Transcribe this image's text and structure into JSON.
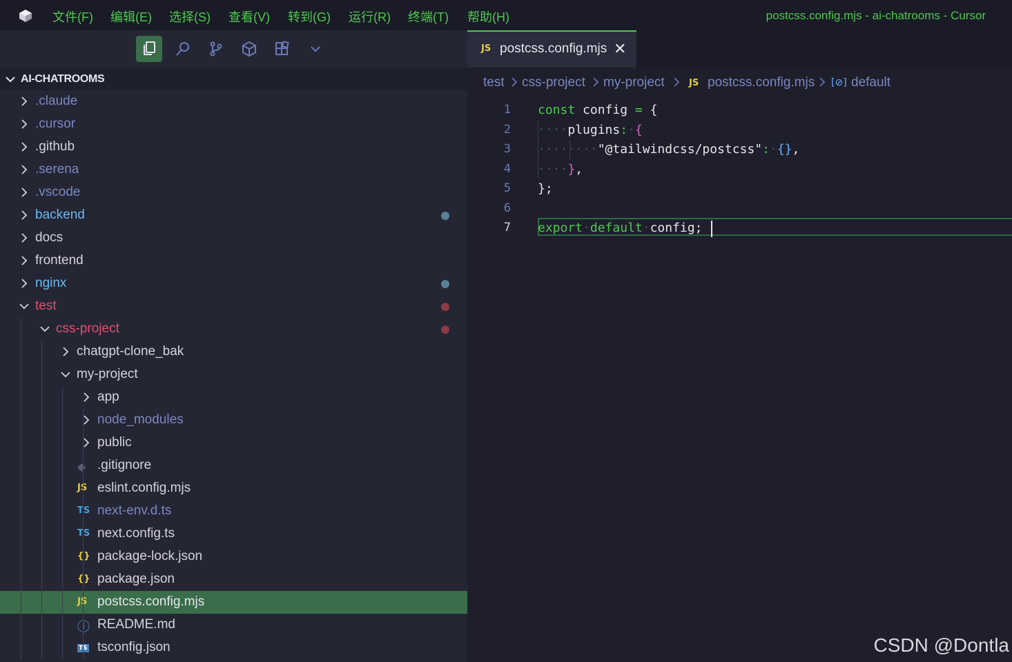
{
  "window": {
    "title": "postcss.config.mjs - ai-chatrooms - Cursor",
    "menu": [
      "文件(F)",
      "编辑(E)",
      "选择(S)",
      "查看(V)",
      "转到(G)",
      "运行(R)",
      "终端(T)",
      "帮助(H)"
    ]
  },
  "activity_bar": {
    "icons": [
      "explorer-icon",
      "search-icon",
      "source-control-icon",
      "extensions-icon",
      "extensions-grid-icon",
      "chevron-down-icon"
    ]
  },
  "explorer": {
    "root": "AI-CHATROOMS",
    "items": [
      {
        "label": ".claude",
        "type": "folder",
        "color": "#7b87c0"
      },
      {
        "label": ".cursor",
        "type": "folder",
        "color": "#7b87c0"
      },
      {
        "label": ".github",
        "type": "folder",
        "color": "#d4d4e0"
      },
      {
        "label": ".serena",
        "type": "folder",
        "color": "#7b87c0"
      },
      {
        "label": ".vscode",
        "type": "folder",
        "color": "#7b87c0"
      },
      {
        "label": "backend",
        "type": "folder",
        "color": "#6ab8f0",
        "dot": "#5b7f95"
      },
      {
        "label": "docs",
        "type": "folder",
        "color": "#d4d4e0"
      },
      {
        "label": "frontend",
        "type": "folder",
        "color": "#d4d4e0"
      },
      {
        "label": "nginx",
        "type": "folder",
        "color": "#6ab8f0",
        "dot": "#5b7f95"
      },
      {
        "label": "test",
        "type": "folder-open",
        "color": "#e0506a",
        "dot": "#8a3a48"
      },
      {
        "label": "css-project",
        "type": "folder-open",
        "color": "#e0506a",
        "dot": "#8a3a48"
      },
      {
        "label": "chatgpt-clone_bak",
        "type": "folder",
        "color": "#d4d4e0"
      },
      {
        "label": "my-project",
        "type": "folder-open",
        "color": "#d4d4e0"
      },
      {
        "label": "app",
        "type": "folder",
        "color": "#d4d4e0"
      },
      {
        "label": "node_modules",
        "type": "folder",
        "color": "#7b87c0"
      },
      {
        "label": "public",
        "type": "folder",
        "color": "#d4d4e0"
      },
      {
        "label": ".gitignore",
        "type": "file",
        "icon": "git-icon",
        "icon_text": "◆",
        "icon_color": "#5a5c70",
        "color": "#d4d4e0"
      },
      {
        "label": "eslint.config.mjs",
        "type": "file",
        "icon": "js-icon",
        "icon_text": "JS",
        "icon_color": "#e6cc44",
        "color": "#d4d4e0"
      },
      {
        "label": "next-env.d.ts",
        "type": "file",
        "icon": "ts-icon",
        "icon_text": "TS",
        "icon_color": "#4a9fd8",
        "color": "#7b87c0"
      },
      {
        "label": "next.config.ts",
        "type": "file",
        "icon": "ts-icon",
        "icon_text": "TS",
        "icon_color": "#4a9fd8",
        "color": "#d4d4e0"
      },
      {
        "label": "package-lock.json",
        "type": "file",
        "icon": "json-icon",
        "icon_text": "{}",
        "icon_color": "#e6cc44",
        "color": "#d4d4e0"
      },
      {
        "label": "package.json",
        "type": "file",
        "icon": "json-icon",
        "icon_text": "{}",
        "icon_color": "#e6cc44",
        "color": "#d4d4e0"
      },
      {
        "label": "postcss.config.mjs",
        "type": "file",
        "icon": "js-icon",
        "icon_text": "JS",
        "icon_color": "#e6cc44",
        "color": "#e6e6ee",
        "selected": true
      },
      {
        "label": "README.md",
        "type": "file",
        "icon": "info-icon",
        "icon_text": "ⓘ",
        "icon_color": "#5aa0d8",
        "color": "#d4d4e0"
      },
      {
        "label": "tsconfig.json",
        "type": "file",
        "icon": "tsconfig-icon",
        "icon_text": "TS",
        "icon_color": "#4a9fd8",
        "color": "#d4d4e0"
      }
    ]
  },
  "tab": {
    "icon": "JS",
    "label": "postcss.config.mjs",
    "close": "✕"
  },
  "breadcrumb": {
    "parts": [
      "test",
      "css-project",
      "my-project",
      "postcss.config.mjs",
      "default"
    ],
    "js_icon": "JS",
    "symbol_icon": "[⊘]"
  },
  "code": {
    "lines": [
      "1",
      "2",
      "3",
      "4",
      "5",
      "6",
      "7"
    ],
    "active_line": "7"
  },
  "watermark": "CSDN @Dontla",
  "colors": {
    "accent": "#4ec94e",
    "selection": "#3a6d4a",
    "folder_modified": "#6ab8f0",
    "folder_error": "#e0506a"
  }
}
